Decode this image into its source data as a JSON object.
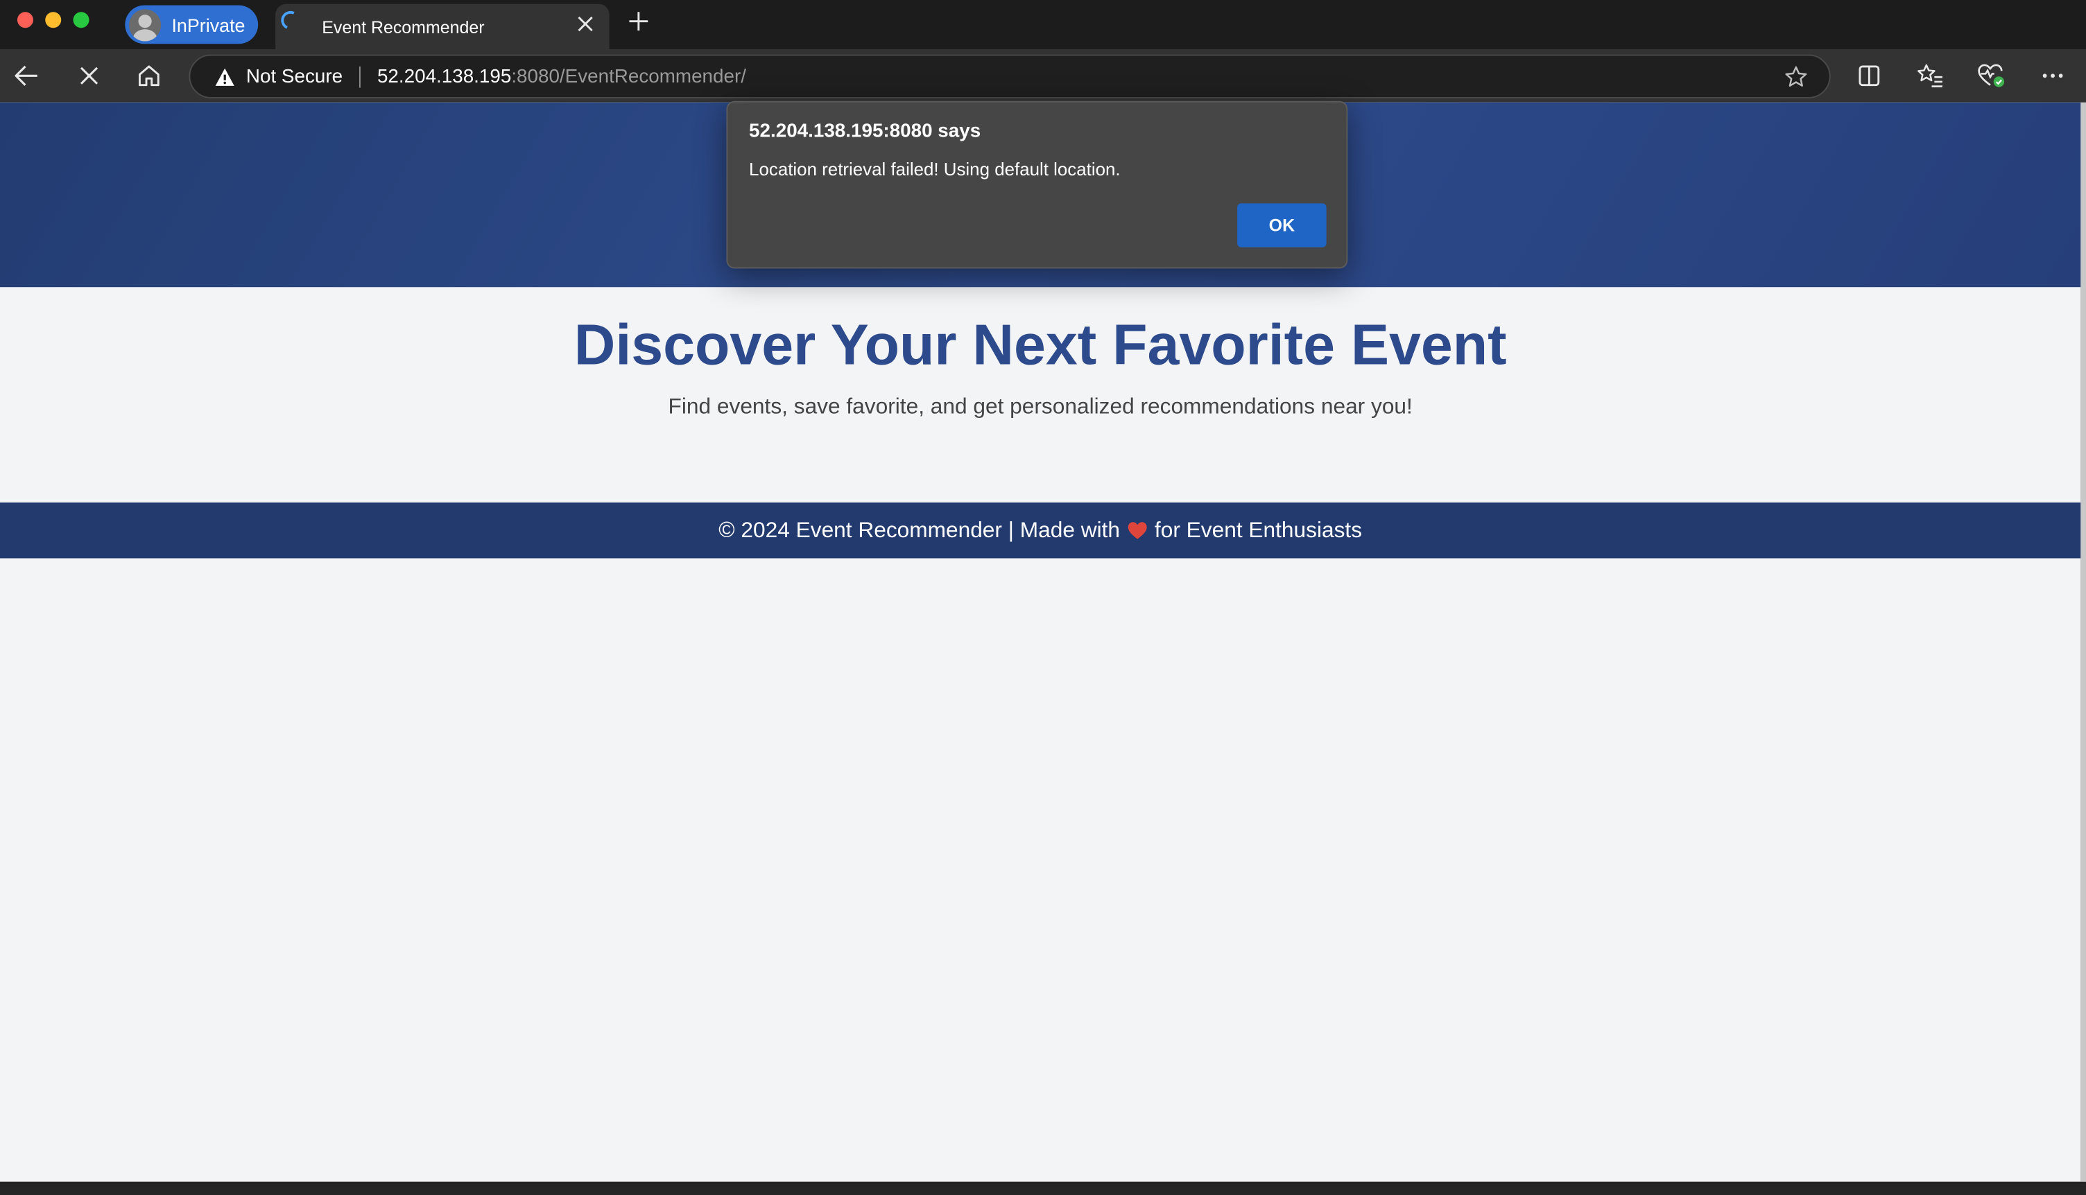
{
  "browser": {
    "profile_label": "InPrivate",
    "tab_title": "Event Recommender",
    "address": {
      "security_label": "Not Secure",
      "host": "52.204.138.195",
      "path": ":8080/EventRecommender/"
    },
    "colors": {
      "profile_pill": "#2f6fd1",
      "loading_spinner": "#4aa3ff"
    }
  },
  "dialog": {
    "title": "52.204.138.195:8080 says",
    "message": "Location retrieval failed! Using default location.",
    "ok_label": "OK",
    "colors": {
      "ok_button": "#1f65c5"
    }
  },
  "page": {
    "heading": "Discover Your Next Favorite Event",
    "subheading": "Find events, save favorite, and get personalized recommendations near you!",
    "footer": {
      "text_before": "© 2024 Event Recommender | Made with",
      "text_after": "for Event Enthusiasts"
    },
    "colors": {
      "header_band": "#2e4b8c",
      "heading_text": "#2d4a8c",
      "footer_band": "#223a6e",
      "background": "#f3f4f6"
    }
  },
  "icons": {
    "back": "arrow-left-icon",
    "stop": "close-icon",
    "home": "home-icon",
    "warning": "warning-triangle-icon",
    "favorite": "star-icon",
    "split_screen": "split-screen-icon",
    "favorites": "favorites-list-icon",
    "browser_essentials": "heart-pulse-icon",
    "more": "more-dots-icon",
    "heart": "heart-icon"
  }
}
